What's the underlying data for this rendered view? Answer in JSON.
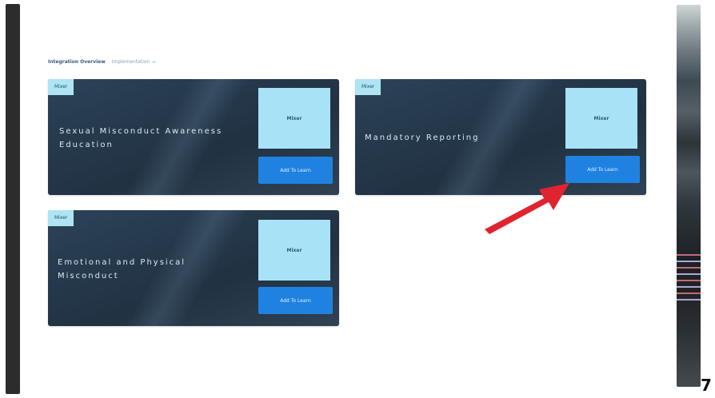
{
  "breadcrumb": {
    "main": "Integration Overview",
    "sub": "Implementation →"
  },
  "cards": [
    {
      "tag": "Mixer",
      "title": "Sexual Misconduct Awareness Education",
      "thumb_label": "Mixer",
      "button_label": "Add To Learn"
    },
    {
      "tag": "Mixer",
      "title": "Mandatory Reporting",
      "thumb_label": "Mixer",
      "button_label": "Add To Learn"
    },
    {
      "tag": "Mixer",
      "title": "Emotional and Physical Misconduct",
      "thumb_label": "Mixer",
      "button_label": "Add To Learn"
    }
  ],
  "slide_number": "7",
  "colors": {
    "card_bg": "#223344",
    "tag_bg": "#aee4f4",
    "thumb_bg": "#a8e2f7",
    "button_bg": "#1f82e0",
    "arrow": "#e0242f"
  },
  "annotation": {
    "icon": "red-arrow-icon",
    "target": "cards.1.button_label"
  }
}
